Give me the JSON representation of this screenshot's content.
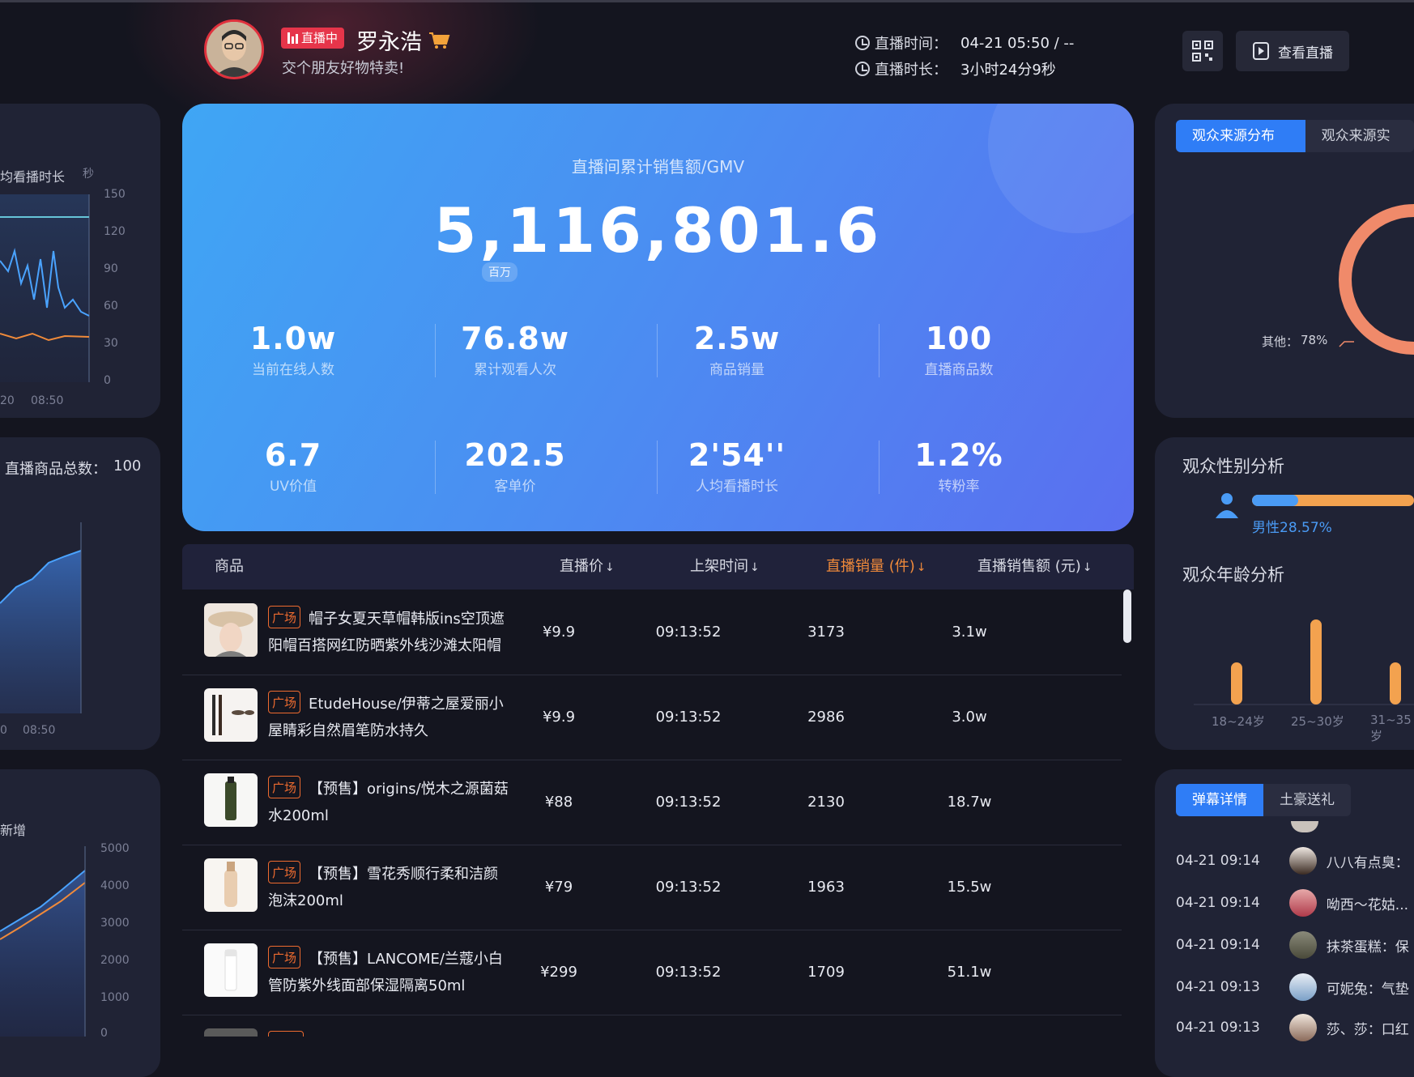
{
  "header": {
    "live_badge": "直播中",
    "host_name": "罗永浩",
    "slogan": "交个朋友好物特卖!",
    "live_time_label": "直播时间：",
    "live_time_value": "04-21 05:50  / --",
    "duration_label": "直播时长：",
    "duration_value": "3小时24分9秒",
    "watch_button": "查看直播"
  },
  "left_panels": {
    "p1_label": "均看播时长",
    "p1_unit": "秒",
    "p1_ticks": [
      "150",
      "120",
      "90",
      "60",
      "30",
      "0"
    ],
    "p1_x_ticks": [
      "20",
      "08:50"
    ],
    "p2_label": "直播商品总数：",
    "p2_value": "100",
    "p2_x_ticks": [
      "0",
      "08:50"
    ],
    "p3_label": "新增",
    "p3_ticks": [
      "5000",
      "4000",
      "3000",
      "2000",
      "1000",
      "0"
    ]
  },
  "hero": {
    "title": "直播间累计销售额/GMV",
    "gmv": "5,116,801.6",
    "unit": "百万",
    "kpis": [
      {
        "value": "1.0w",
        "label": "当前在线人数"
      },
      {
        "value": "76.8w",
        "label": "累计观看人次"
      },
      {
        "value": "2.5w",
        "label": "商品销量"
      },
      {
        "value": "100",
        "label": "直播商品数"
      },
      {
        "value": "6.7",
        "label": "UV价值"
      },
      {
        "value": "202.5",
        "label": "客单价"
      },
      {
        "value": "2'54''",
        "label": "人均看播时长"
      },
      {
        "value": "1.2%",
        "label": "转粉率"
      }
    ]
  },
  "table": {
    "headers": {
      "product": "商品",
      "price": "直播价",
      "time": "上架时间",
      "sales": "直播销量 (件)",
      "amount": "直播销售额 (元)"
    },
    "sort_arrow": "↓",
    "rows": [
      {
        "tag": "广场",
        "name": "帽子女夏天草帽韩版ins空顶遮阳帽百搭网红防晒紫外线沙滩太阳帽",
        "price": "¥9.9",
        "time": "09:13:52",
        "sales": "3173",
        "amount": "3.1w"
      },
      {
        "tag": "广场",
        "name": "EtudeHouse/伊蒂之屋爱丽小屋睛彩自然眉笔防水持久",
        "price": "¥9.9",
        "time": "09:13:52",
        "sales": "2986",
        "amount": "3.0w"
      },
      {
        "tag": "广场",
        "name": "【预售】origins/悦木之源菌菇水200ml",
        "price": "¥88",
        "time": "09:13:52",
        "sales": "2130",
        "amount": "18.7w"
      },
      {
        "tag": "广场",
        "name": "【预售】雪花秀顺行柔和洁颜泡沫200ml",
        "price": "¥79",
        "time": "09:13:52",
        "sales": "1963",
        "amount": "15.5w"
      },
      {
        "tag": "广场",
        "name": "【预售】LANCOME/兰蔻小白管防紫外线面部保湿隔离50ml",
        "price": "¥299",
        "time": "09:13:52",
        "sales": "1709",
        "amount": "51.1w"
      }
    ]
  },
  "right_panels": {
    "source_tab_active": "观众来源分布",
    "source_tab_other": "观众来源实时",
    "source_other_label": "其他：",
    "source_other_value": "78%",
    "gender_title": "观众性别分析",
    "gender_male_label": "男性28.57%",
    "gender_male_fraction": 0.2857,
    "age_title": "观众年龄分析",
    "age_categories": [
      "18~24岁",
      "25~30岁",
      "31~35岁"
    ],
    "danmu_tab_active": "弹幕详情",
    "danmu_tab_other": "土豪送礼",
    "danmu": [
      {
        "time": "04-21 09:14",
        "text": "八八有点臭："
      },
      {
        "time": "04-21 09:14",
        "text": "呦西～花姑..."
      },
      {
        "time": "04-21 09:14",
        "text": "抹茶蛋糕：保"
      },
      {
        "time": "04-21 09:13",
        "text": "可妮兔：气垫"
      },
      {
        "time": "04-21 09:13",
        "text": "莎、莎：口红"
      }
    ]
  },
  "colors": {
    "accent_blue": "#2f7df6",
    "live_red": "#e6354a",
    "sort_orange": "#f08a3a",
    "tag_orange": "#ee6b2f"
  }
}
